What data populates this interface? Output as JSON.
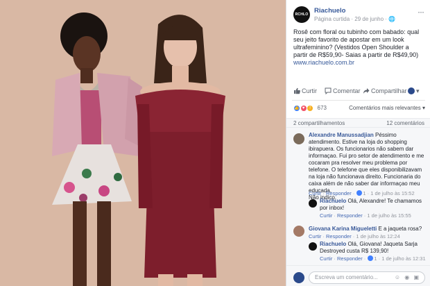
{
  "post": {
    "logo_text": "RCHLO",
    "page_name": "Riachuelo",
    "meta": "Página curtida · 29 de junho · 🌐",
    "text": "Rosê com floral ou tubinho com babado: qual seu jeito favorito de apostar em um look ultrafeminino? (Vestidos Open Shoulder a partir de R$59,90- Saias a partir de R$49,90)",
    "link": "www.riachuelo.com.br"
  },
  "actions": {
    "like": "Curtir",
    "comment": "Comentar",
    "share": "Compartilhar"
  },
  "reactions": {
    "count": "673",
    "relevance": "Comentários mais relevantes ▾"
  },
  "stats": {
    "shares": "2 compartilhamentos",
    "comments": "12 comentários"
  },
  "comments": [
    {
      "author": "Alexandre Manussadjian",
      "text": "Péssimo atendimento. Estive na loja do shopping ibirapuera. Os funcionarios não sabem dar informaçao. Fui pro setor de atendimento e me cocaram pra resolver meu problema por telefone. O telefone que eles disponibilizavam na loja não funcionava direito. Funcionaria do caixa além de não saber dar informaçao meu educada.",
      "tail": "Não indico.",
      "like": "Curtir",
      "reply": "Responder",
      "reacts": "1",
      "date": "1 de julho às 15:52"
    },
    {
      "author": "Riachuelo",
      "text": "Olá, Alexandre! Te chamamos por inbox!",
      "like": "Curtir",
      "reply": "Responder",
      "date": "1 de julho às 15:55"
    },
    {
      "author": "Giovana Karina Migueletti",
      "text": "E a jaqueta rosa?",
      "like": "Curtir",
      "reply": "Responder",
      "date": "1 de julho às 12:24"
    },
    {
      "author": "Riachuelo",
      "text": "Olá, Giovana! Jaqueta Sarja Destroyed custa R$ 139,90!",
      "like": "Curtir",
      "reply": "Responder",
      "reacts": "1",
      "date": "1 de julho às 12:31"
    }
  ],
  "composer": {
    "placeholder": "Escreva um comentário..."
  },
  "icons": [
    "like-icon",
    "comment-icon",
    "share-icon",
    "globe-icon",
    "more-icon",
    "verified-icon"
  ],
  "colors": {
    "photo_bg": "#d9b8a4",
    "link": "#365899",
    "dress": "#7d1e2c",
    "jacket": "#d8a9b4"
  }
}
